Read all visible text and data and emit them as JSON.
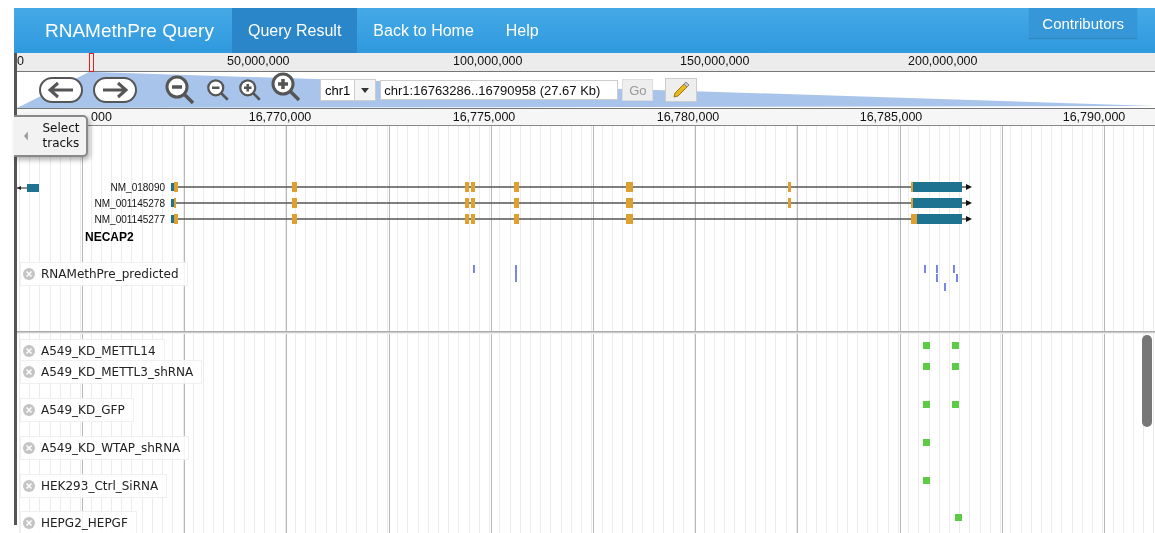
{
  "nav": {
    "title": "RNAMethPre Query",
    "tabs": [
      {
        "label": "Query Result",
        "selected": true
      },
      {
        "label": "Back to Home",
        "selected": false
      },
      {
        "label": "Help",
        "selected": false
      }
    ],
    "contributors": "Contributors"
  },
  "overview": {
    "ticks": [
      "0",
      "50,000,000",
      "100,000,000",
      "150,000,000",
      "200,000,000"
    ]
  },
  "toolbar": {
    "chromosome": "chr1",
    "location": "chr1:16763286..16790958 (27.67 Kb)",
    "go": "Go"
  },
  "ruler": {
    "ticks": [
      "000",
      "16,770,000",
      "16,775,000",
      "16,780,000",
      "16,785,000",
      "16,790,000"
    ]
  },
  "select_tracks": "Select tracks",
  "gene": {
    "transcripts": [
      "NM_018090",
      "NM_001145278",
      "NM_001145277"
    ],
    "name": "NECAP2"
  },
  "tracks": [
    {
      "label": "RNAMethPre_predicted"
    },
    {
      "label": "A549_KD_METTL14"
    },
    {
      "label": "A549_KD_METTL3_shRNA"
    },
    {
      "label": "A549_KD_GFP"
    },
    {
      "label": "A549_KD_WTAP_shRNA"
    },
    {
      "label": "HEK293_Ctrl_SiRNA"
    },
    {
      "label": "HEPG2_HEPGF"
    }
  ]
}
